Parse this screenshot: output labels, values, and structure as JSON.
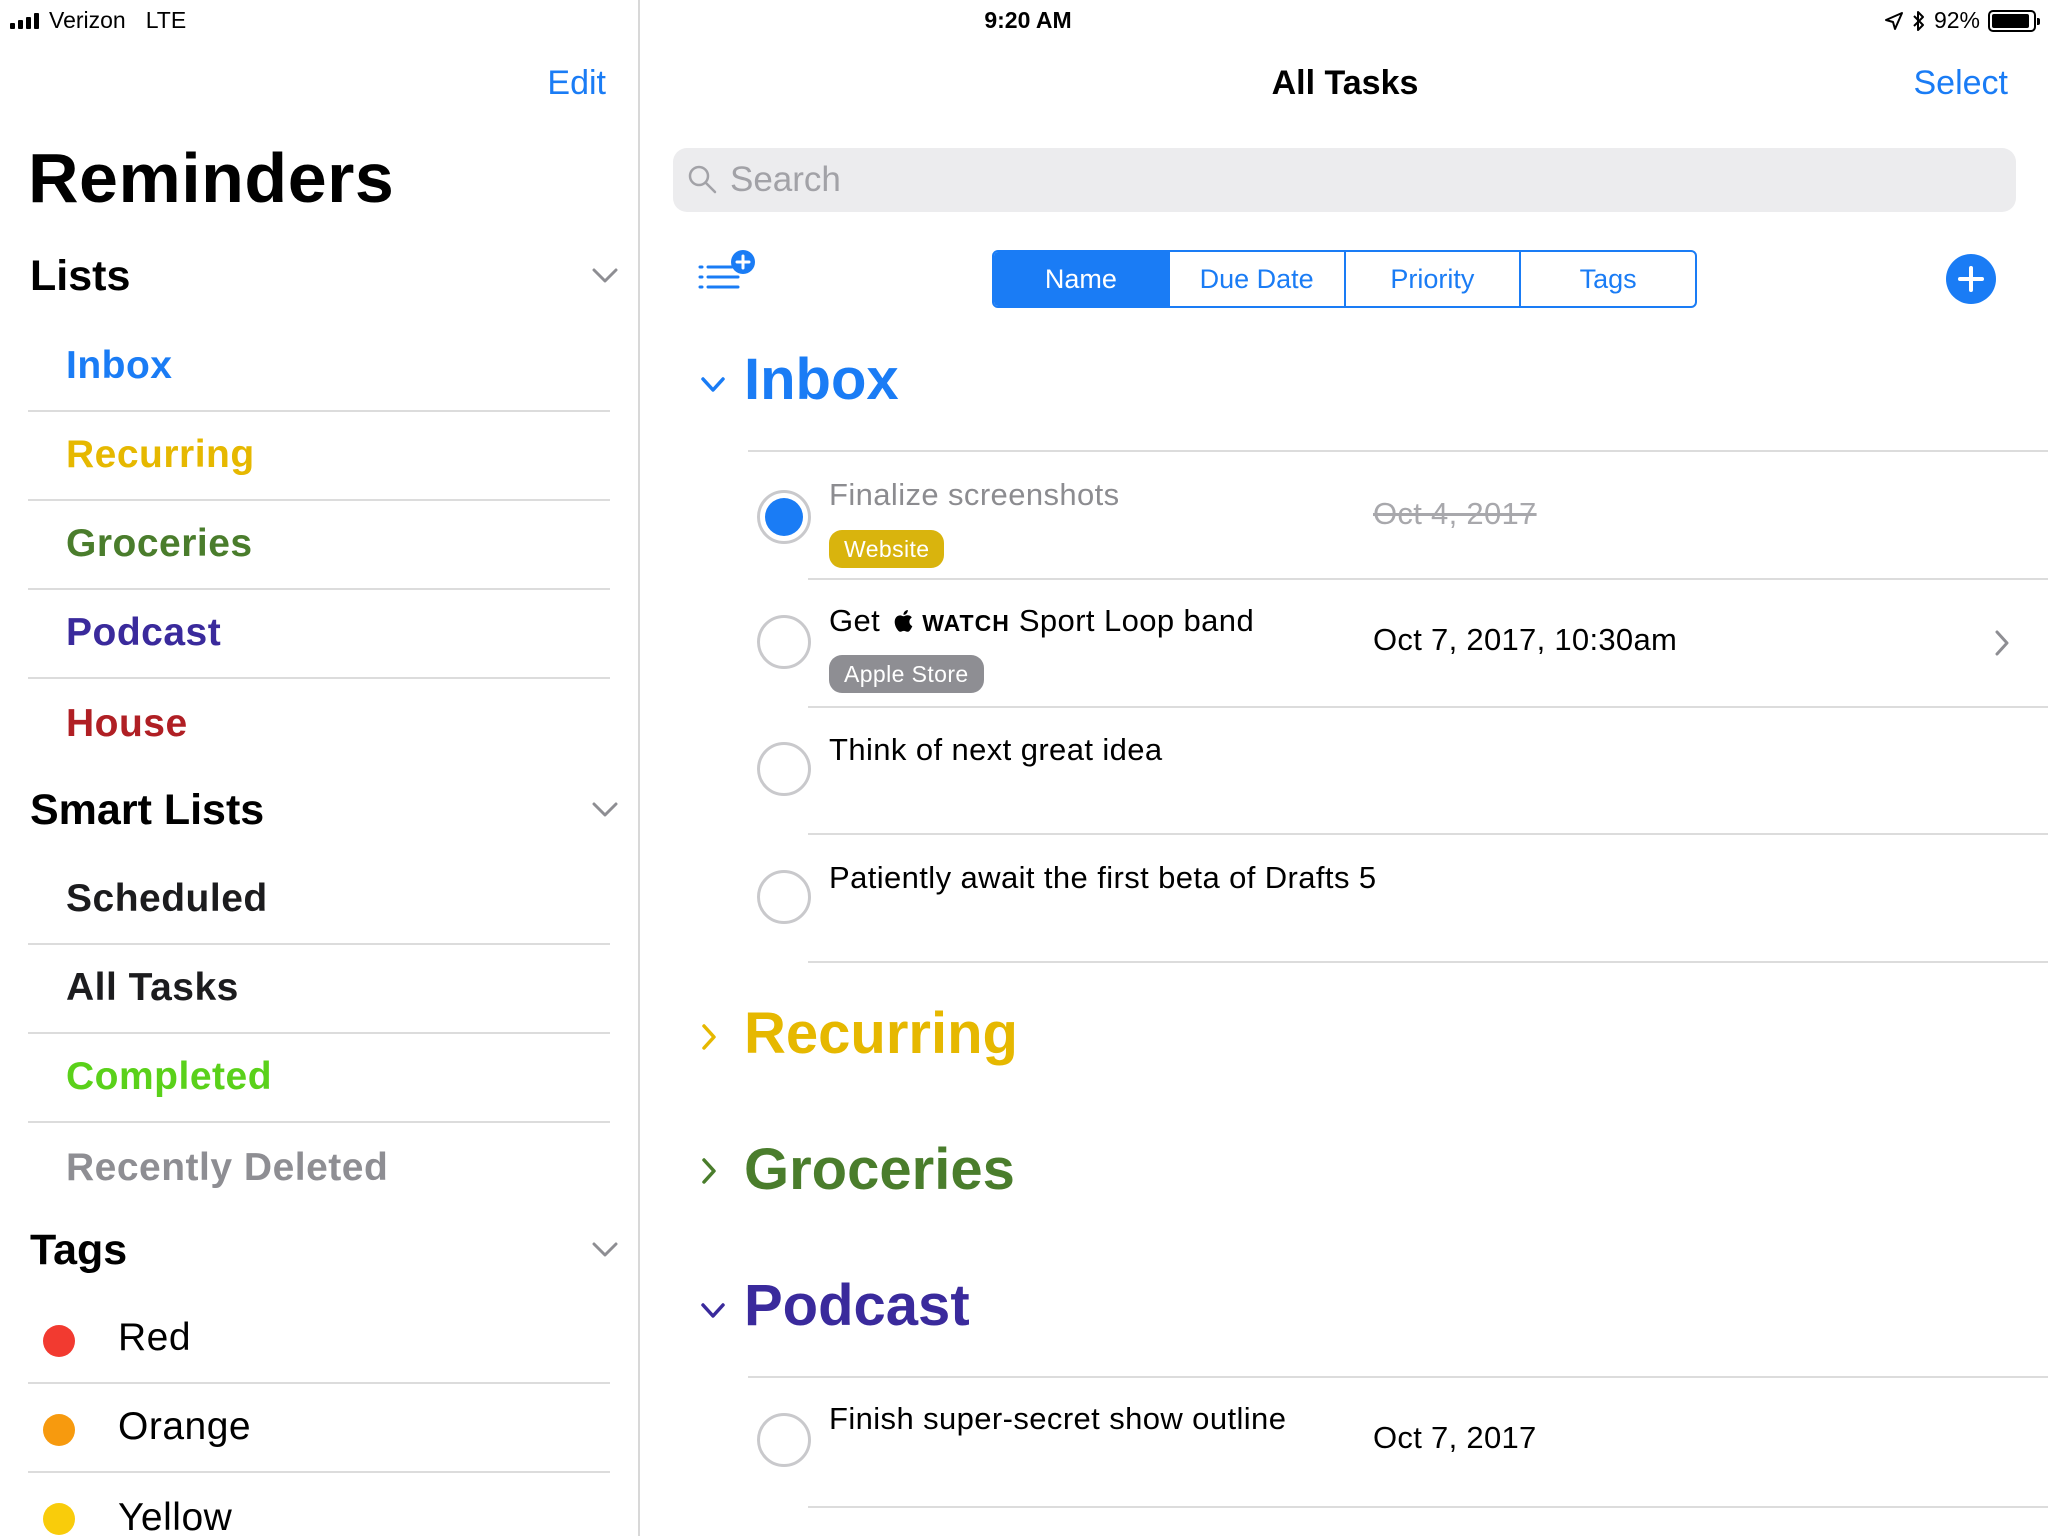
{
  "status": {
    "carrier": "Verizon",
    "network": "LTE",
    "time": "9:20 AM",
    "battery": "92%",
    "battery_level": 0.92
  },
  "sidebar": {
    "edit_label": "Edit",
    "title": "Reminders",
    "lists_heading": "Lists",
    "lists": [
      {
        "label": "Inbox",
        "color": "#1a7cf5"
      },
      {
        "label": "Recurring",
        "color": "#e6b800"
      },
      {
        "label": "Groceries",
        "color": "#4a7d2c"
      },
      {
        "label": "Podcast",
        "color": "#3a2a9c"
      },
      {
        "label": "House",
        "color": "#b01f24"
      }
    ],
    "smart_heading": "Smart Lists",
    "smart_lists": [
      {
        "label": "Scheduled",
        "color": "#1c1c1e"
      },
      {
        "label": "All Tasks",
        "color": "#1c1c1e"
      },
      {
        "label": "Completed",
        "color": "#5ad11a"
      },
      {
        "label": "Recently Deleted",
        "color": "#8e8e93"
      }
    ],
    "tags_heading": "Tags",
    "tags": [
      {
        "label": "Red",
        "color": "#f23a30"
      },
      {
        "label": "Orange",
        "color": "#f79a0e"
      },
      {
        "label": "Yellow",
        "color": "#f9cc0b"
      }
    ]
  },
  "main": {
    "title": "All Tasks",
    "select_label": "Select",
    "search_placeholder": "Search",
    "sort_options": [
      "Name",
      "Due Date",
      "Priority",
      "Tags"
    ],
    "sort_selected": "Name",
    "groups": [
      {
        "title": "Inbox",
        "color": "#1a7cf5",
        "expanded": true
      },
      {
        "title": "Recurring",
        "color": "#e6b800",
        "expanded": false
      },
      {
        "title": "Groceries",
        "color": "#4a7d2c",
        "expanded": false
      },
      {
        "title": "Podcast",
        "color": "#3a2a9c",
        "expanded": true
      }
    ],
    "inbox_tasks": [
      {
        "title": "Finalize screenshots",
        "tag": "Website",
        "tag_color": "#d9b40d",
        "date": "Oct 4, 2017",
        "completed": true
      },
      {
        "title_prefix": "Get",
        "title_watch": "WATCH",
        "title_suffix": "Sport Loop band",
        "tag": "Apple Store",
        "tag_color": "#8e8e93",
        "date": "Oct 7, 2017, 10:30am",
        "completed": false
      },
      {
        "title": "Think of next great idea",
        "completed": false
      },
      {
        "title": "Patiently await the first beta of Drafts 5",
        "completed": false
      }
    ],
    "podcast_tasks": [
      {
        "title": "Finish super-secret show outline",
        "date": "Oct 7, 2017",
        "completed": false
      }
    ]
  }
}
